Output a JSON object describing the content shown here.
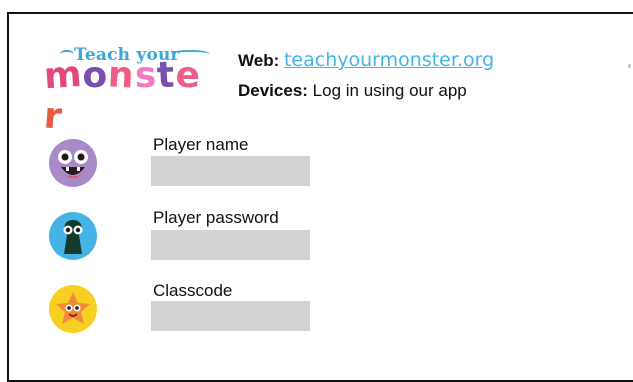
{
  "logo": {
    "top_text": "Teach your",
    "main_letters": [
      "m",
      "o",
      "n",
      "s",
      "t",
      "e",
      "r"
    ]
  },
  "info": {
    "web_label": "Web:",
    "web_value": "teachyourmonster.org",
    "devices_label": "Devices:",
    "devices_value": "Log in using our app"
  },
  "fields": [
    {
      "label": "Player name",
      "value": "",
      "avatar": "purple-monster-icon"
    },
    {
      "label": "Player password",
      "value": "",
      "avatar": "keyhole-monster-icon"
    },
    {
      "label": "Classcode",
      "value": "",
      "avatar": "star-monster-icon"
    }
  ],
  "colors": {
    "link": "#42b6e3",
    "input_bg": "#d2d3d4",
    "avatar_purple": "#a98ac8",
    "avatar_blue": "#44b4e6",
    "avatar_yellow": "#f7cf21",
    "star_orange": "#f28a3a",
    "logo_blue": "#3aa7d8",
    "logo_pink": "#e2497b",
    "logo_purple": "#7a4fb0"
  }
}
